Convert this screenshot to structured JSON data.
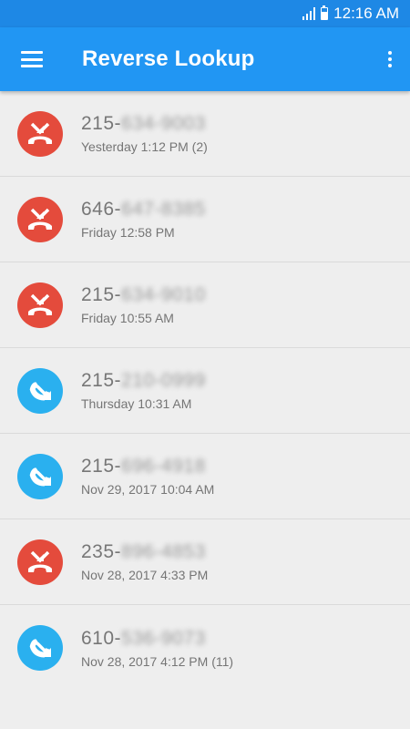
{
  "status_bar": {
    "time": "12:16 AM"
  },
  "app_bar": {
    "title": "Reverse Lookup"
  },
  "colors": {
    "missed": "#e44b3c",
    "outgoing": "#2ab0ef",
    "appbar": "#2196f3",
    "statusbar": "#1e88e5"
  },
  "calls": [
    {
      "prefix": "215-",
      "rest": "634-9003",
      "time": "Yesterday 1:12 PM (2)",
      "type": "missed",
      "icon": "missed-call-icon"
    },
    {
      "prefix": "646-",
      "rest": "647-8385",
      "time": "Friday 12:58 PM",
      "type": "missed",
      "icon": "missed-call-icon"
    },
    {
      "prefix": "215-",
      "rest": "634-9010",
      "time": "Friday 10:55 AM",
      "type": "missed",
      "icon": "missed-call-icon"
    },
    {
      "prefix": "215-",
      "rest": "210-0999",
      "time": "Thursday 10:31 AM",
      "type": "outgoing",
      "icon": "outgoing-call-icon"
    },
    {
      "prefix": "215-",
      "rest": "696-4918",
      "time": "Nov 29, 2017 10:04 AM",
      "type": "outgoing",
      "icon": "outgoing-call-icon"
    },
    {
      "prefix": "235-",
      "rest": "896-4853",
      "time": "Nov 28, 2017 4:33 PM",
      "type": "missed",
      "icon": "missed-call-icon"
    },
    {
      "prefix": "610-",
      "rest": "536-9073",
      "time": "Nov 28, 2017 4:12 PM (11)",
      "type": "outgoing",
      "icon": "outgoing-call-icon"
    }
  ]
}
